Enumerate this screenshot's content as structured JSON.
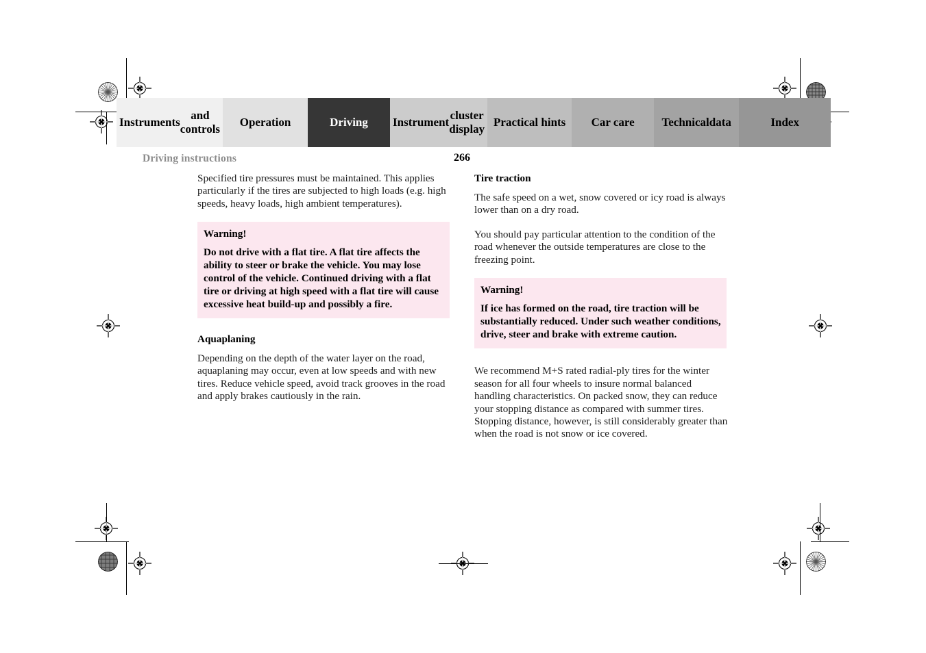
{
  "document": {
    "running_head": "Driving instructions",
    "page_number": "266"
  },
  "tabs": [
    {
      "label": "Instruments\nand controls",
      "bg": "#f0f0f0",
      "active": false
    },
    {
      "label": "Operation",
      "bg": "#e1e1e1",
      "active": false
    },
    {
      "label": "Driving",
      "bg": "#363636",
      "active": true
    },
    {
      "label": "Instrument\ncluster display",
      "bg": "#cccccc",
      "active": false
    },
    {
      "label": "Practical hints",
      "bg": "#bebebe",
      "active": false
    },
    {
      "label": "Car care",
      "bg": "#b0b0b0",
      "active": false
    },
    {
      "label": "Technical\ndata",
      "bg": "#a3a3a3",
      "active": false
    },
    {
      "label": "Index",
      "bg": "#969696",
      "active": false
    }
  ],
  "colors": {
    "warning_bg": "#fce7ef",
    "running_head": "#8c8c8c",
    "active_tab_bg": "#363636",
    "page_bg": "#ffffff"
  },
  "left_column": {
    "intro_paragraph": "Specified tire pressures must be maintained. This applies particularly if the tires are subjected to high loads (e.g. high speeds, heavy loads, high ambient temperatures).",
    "warning": {
      "title": "Warning!",
      "body": "Do not drive with a flat tire. A flat tire affects the ability to steer or brake the vehicle. You may lose control of the vehicle. Continued driving with a flat tire or driving at high speed with a flat tire will cause excessive heat build-up and possibly a fire."
    },
    "aquaplaning_heading": "Aquaplaning",
    "aquaplaning_paragraph": "Depending on the depth of the water layer on the road, aquaplaning may occur, even at low speeds and with new tires. Reduce vehicle speed, avoid track grooves in the road and apply brakes cautiously in the rain."
  },
  "right_column": {
    "tire_traction_heading": "Tire traction",
    "paragraph_1": "The safe speed on a wet, snow covered or icy road is always lower than on a dry road.",
    "paragraph_2": "You should pay particular attention to the condition of the road whenever the outside temperatures are close to the freezing point.",
    "warning": {
      "title": "Warning!",
      "body": "If ice has formed on the road, tire traction will be substantially reduced. Under such weather conditions, drive, steer and brake with extreme caution."
    },
    "paragraph_3": "We recommend M+S rated radial-ply tires for the winter season for all four wheels to insure normal balanced handling characteristics. On packed snow, they can reduce your stopping distance as compared with summer tires. Stopping distance, however, is still considerably greater than when the road is not snow or ice covered."
  }
}
